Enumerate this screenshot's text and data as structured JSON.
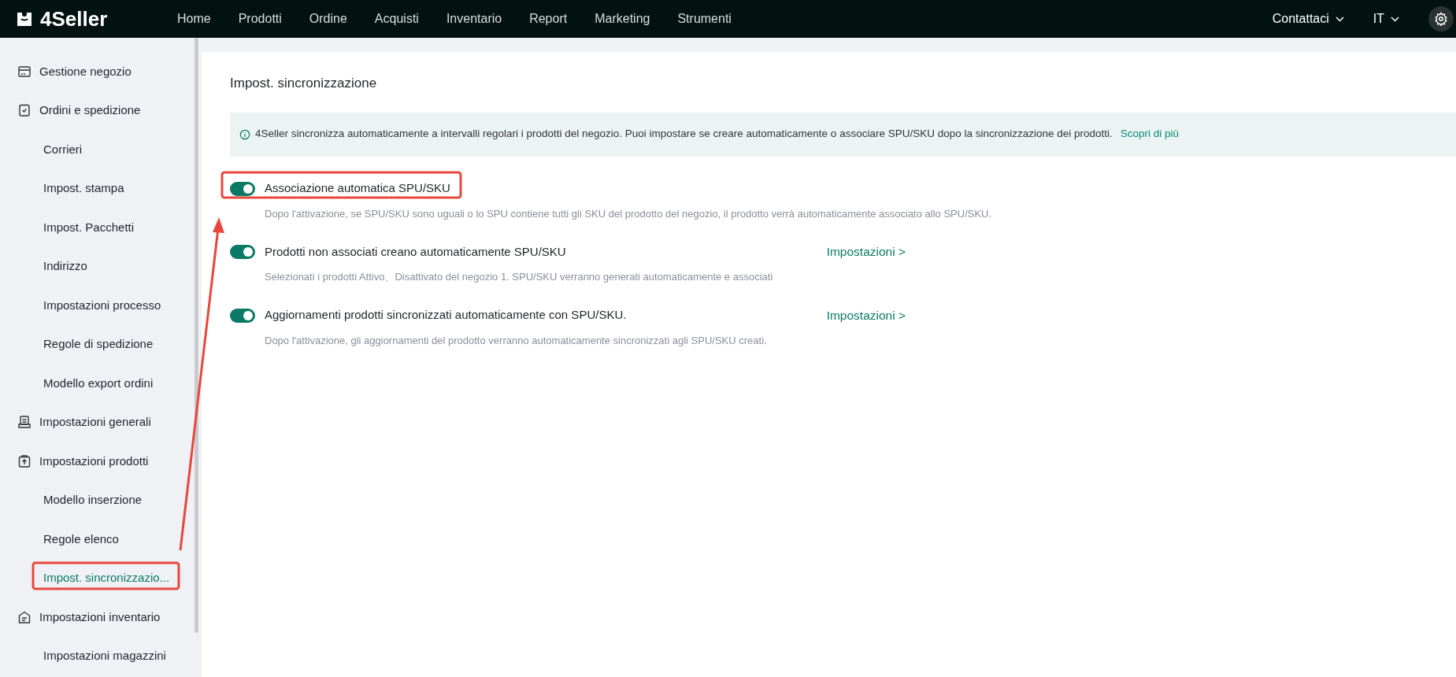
{
  "header": {
    "logo": "4Seller",
    "nav": [
      "Home",
      "Prodotti",
      "Ordine",
      "Acquisti",
      "Inventario",
      "Report",
      "Marketing",
      "Strumenti"
    ],
    "contact": "Contattaci",
    "language": "IT"
  },
  "sidebar": {
    "groups": [
      {
        "label": "Gestione negozio"
      },
      {
        "label": "Ordini e spedizione",
        "children": [
          {
            "label": "Corrieri",
            "selected": false
          },
          {
            "label": "Impost. stampa",
            "selected": false
          },
          {
            "label": "Impost. Pacchetti",
            "selected": false
          },
          {
            "label": "Indirizzo",
            "selected": false
          },
          {
            "label": "Impostazioni processo",
            "selected": false
          },
          {
            "label": "Regole di spedizione",
            "selected": false
          },
          {
            "label": "Modello export ordini",
            "selected": false
          }
        ]
      },
      {
        "label": "Impostazioni generali"
      },
      {
        "label": "Impostazioni prodotti",
        "children": [
          {
            "label": "Modello inserzione",
            "selected": false
          },
          {
            "label": "Regole elenco",
            "selected": false
          },
          {
            "label": "Impost. sincronizzazio...",
            "selected": true
          }
        ]
      },
      {
        "label": "Impostazioni inventario",
        "children": [
          {
            "label": "Impostazioni magazzini",
            "selected": false
          }
        ]
      }
    ]
  },
  "content": {
    "title": "Impost. sincronizzazione",
    "notice": {
      "text": "4Seller sincronizza automaticamente a intervalli regolari i prodotti del negozio. Puoi impostare se creare automaticamente o associare SPU/SKU dopo la sincronizzazione dei prodotti.",
      "link": "Scopri di più"
    },
    "settings": [
      {
        "label": "Associazione automatica SPU/SKU",
        "on": true,
        "description": "Dopo l'attivazione, se SPU/SKU sono uguali o lo SPU contiene tutti gli SKU del prodotto del negozio, il prodotto verrà automaticamente associato allo SPU/SKU."
      },
      {
        "label": "Prodotti non associati creano automaticamente SPU/SKU",
        "on": true,
        "link": "Impostazioni >",
        "description": "Selezionati i prodotti Attivo、Disattivato del negozio 1. SPU/SKU verranno generati automaticamente e associati"
      },
      {
        "label": "Aggiornamenti prodotti sincronizzati automaticamente con SPU/SKU.",
        "on": true,
        "link": "Impostazioni >",
        "description": "Dopo l'attivazione, gli aggiornamenti del prodotto verranno automaticamente sincronizzati agli SPU/SKU creati."
      }
    ]
  }
}
